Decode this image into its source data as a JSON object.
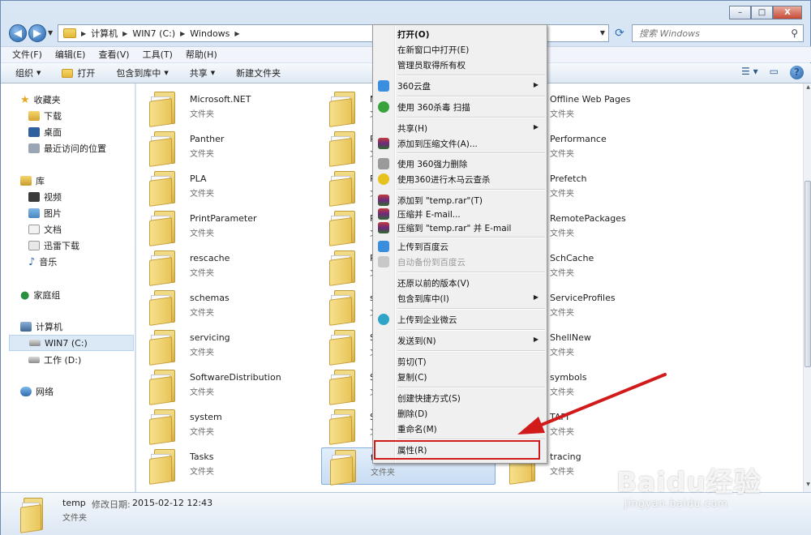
{
  "window": {
    "buttons": {
      "minimize": "–",
      "maximize": "□",
      "close": "X"
    }
  },
  "address": {
    "back_label": "◀",
    "forward_label": "▶",
    "crumbs": [
      "计算机",
      "WIN7 (C:)",
      "Windows"
    ],
    "search_placeholder": "搜索 Windows"
  },
  "menubar": [
    "文件(F)",
    "编辑(E)",
    "查看(V)",
    "工具(T)",
    "帮助(H)"
  ],
  "cmdbar": {
    "organize": "组织",
    "open": "打开",
    "include_library": "包含到库中",
    "share": "共享",
    "new_folder": "新建文件夹"
  },
  "nav": {
    "favorites": "收藏夹",
    "downloads": "下载",
    "desktop": "桌面",
    "recent": "最近访问的位置",
    "libraries": "库",
    "videos": "视频",
    "pictures": "图片",
    "documents": "文档",
    "thunder": "迅雷下载",
    "music": "音乐",
    "homegroup": "家庭组",
    "computer": "计算机",
    "drive_c": "WIN7 (C:)",
    "drive_d": "工作 (D:)",
    "network": "网络"
  },
  "files": {
    "type_label": "文件夹",
    "col1": [
      "Microsoft.NET",
      "Panther",
      "PLA",
      "PrintParameter",
      "rescache",
      "schemas",
      "servicing",
      "SoftwareDistribution",
      "system",
      "Tasks"
    ],
    "col2": [
      "M",
      "P",
      "P",
      "R",
      "R",
      "s",
      "S",
      "S",
      "S",
      "temp"
    ],
    "col3": [
      "Offline Web Pages",
      "Performance",
      "Prefetch",
      "RemotePackages",
      "SchCache",
      "ServiceProfiles",
      "ShellNew",
      "symbols",
      "TAPI",
      "tracing"
    ]
  },
  "details": {
    "name": "temp",
    "modified_label": "修改日期:",
    "modified": "2015-02-12 12:43",
    "type": "文件夹"
  },
  "context_menu": {
    "open": "打开(O)",
    "open_new_window": "在新窗口中打开(E)",
    "take_ownership": "管理员取得所有权",
    "cloud360": "360云盘",
    "scan360": "使用 360杀毒 扫描",
    "share": "共享(H)",
    "add_archive": "添加到压缩文件(A)...",
    "force_delete": "使用 360强力删除",
    "trojan_scan": "使用360进行木马云查杀",
    "add_temp_rar": "添加到 \"temp.rar\"(T)",
    "compress_email": "压缩并 E-mail...",
    "compress_temp_email": "压缩到 \"temp.rar\" 并 E-mail",
    "upload_baidu": "上传到百度云",
    "auto_backup_baidu": "自动备份到百度云",
    "restore_previous": "还原以前的版本(V)",
    "include_library": "包含到库中(I)",
    "upload_enterprise": "上传到企业微云",
    "send_to": "发送到(N)",
    "cut": "剪切(T)",
    "copy": "复制(C)",
    "create_shortcut": "创建快捷方式(S)",
    "delete": "删除(D)",
    "rename": "重命名(M)",
    "properties": "属性(R)"
  },
  "watermark": {
    "main": "Baidu经验",
    "sub": "jingyan.baidu.com"
  },
  "colors": {
    "highlight_red": "#d11a1a",
    "selection_blue": "#c9ddf3",
    "accent": "#215fa6"
  }
}
